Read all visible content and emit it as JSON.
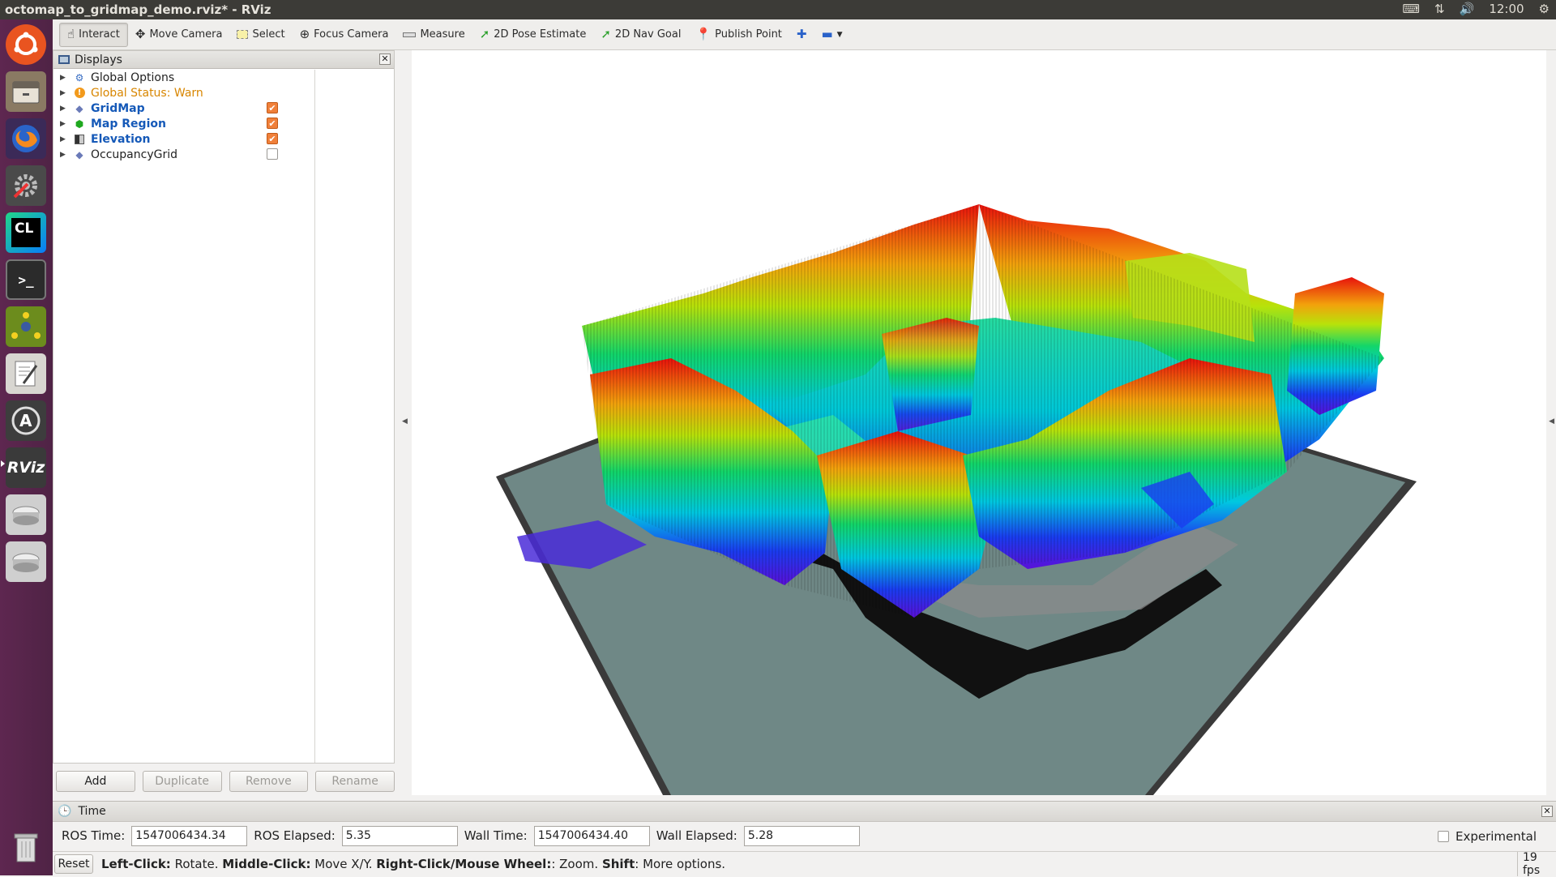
{
  "window": {
    "title": "octomap_to_gridmap_demo.rviz* - RViz",
    "clock": "12:00"
  },
  "launcher": {
    "items": [
      "ubuntu-icon",
      "files-icon",
      "firefox-icon",
      "settings-icon",
      "clion-icon",
      "terminal-icon",
      "network-icon",
      "text-editor-icon",
      "software-updater-icon",
      "rviz-icon",
      "drive-icon",
      "drive-icon",
      "trash-icon"
    ],
    "clion_label": "CL",
    "rviz_label": "RViz"
  },
  "toolbar": {
    "interact": "Interact",
    "move_camera": "Move Camera",
    "select": "Select",
    "focus_camera": "Focus Camera",
    "measure": "Measure",
    "pose_estimate": "2D Pose Estimate",
    "nav_goal": "2D Nav Goal",
    "publish_point": "Publish Point"
  },
  "displays": {
    "title": "Displays",
    "items": [
      {
        "label": "Global Options",
        "checked": null
      },
      {
        "label": "Global Status: Warn",
        "checked": null
      },
      {
        "label": "GridMap",
        "checked": true
      },
      {
        "label": "Map Region",
        "checked": true
      },
      {
        "label": "Elevation",
        "checked": true
      },
      {
        "label": "OccupancyGrid",
        "checked": false
      }
    ],
    "buttons": {
      "add": "Add",
      "duplicate": "Duplicate",
      "remove": "Remove",
      "rename": "Rename"
    }
  },
  "time": {
    "title": "Time",
    "ros_time_label": "ROS Time:",
    "ros_time": "1547006434.34",
    "ros_elapsed_label": "ROS Elapsed:",
    "ros_elapsed": "5.35",
    "wall_time_label": "Wall Time:",
    "wall_time": "1547006434.40",
    "wall_elapsed_label": "Wall Elapsed:",
    "wall_elapsed": "5.28",
    "experimental": "Experimental"
  },
  "status": {
    "reset": "Reset",
    "m1": "Left-Click:",
    "m2": " Rotate. ",
    "m3": "Middle-Click:",
    "m4": " Move X/Y. ",
    "m5": "Right-Click/Mouse Wheel:",
    "m6": ": Zoom. ",
    "m7": "Shift",
    "m8": ": More options.",
    "fps": "19 fps"
  },
  "colors": {
    "accent_orange": "#f0803a",
    "warn": "#d88600",
    "link_blue": "#1559b8",
    "ground": "#6f8886"
  }
}
